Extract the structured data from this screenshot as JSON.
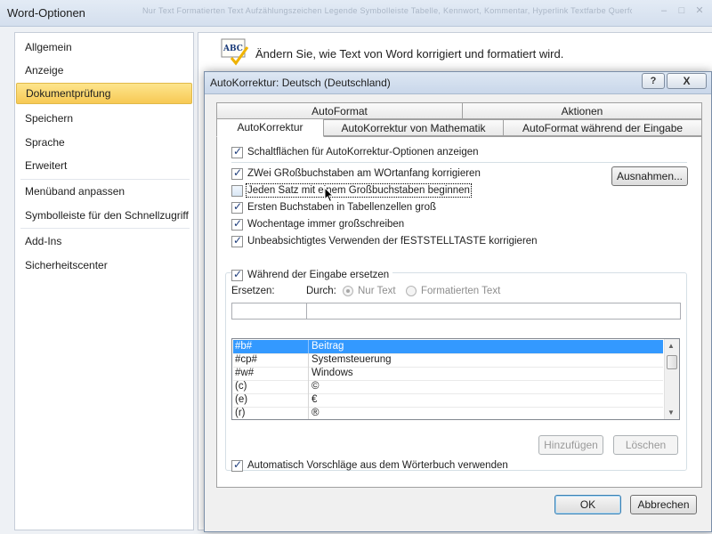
{
  "window": {
    "title": "Word-Optionen",
    "background_text": "Nur Text Formatierten Text Aufzählungszeichen Legende Symbolleiste Tabelle, Kennwort, Kommentar, Hyperlink Textfarbe Querformat Dokument Layout Ansicht"
  },
  "nav": {
    "items": [
      {
        "label": "Allgemein"
      },
      {
        "label": "Anzeige"
      },
      {
        "label": "Dokumentprüfung"
      },
      {
        "label": "Speichern"
      },
      {
        "label": "Sprache"
      },
      {
        "label": "Erweitert"
      },
      {
        "label": "Menüband anpassen"
      },
      {
        "label": "Symbolleiste für den Schnellzugriff"
      },
      {
        "label": "Add-Ins"
      },
      {
        "label": "Sicherheitscenter"
      }
    ],
    "active_index": 2
  },
  "content": {
    "icon": "abc-check-icon",
    "icon_text": "ABC",
    "heading": "Ändern Sie, wie Text von Word korrigiert und formatiert wird."
  },
  "dialog": {
    "title": "AutoKorrektur: Deutsch (Deutschland)",
    "help_label": "?",
    "close_label": "X",
    "tabs_top": [
      "AutoFormat",
      "Aktionen"
    ],
    "tabs_bottom": [
      "AutoKorrektur",
      "AutoKorrektur von Mathematik",
      "AutoFormat während der Eingabe"
    ],
    "active_tab": "AutoKorrektur",
    "show_buttons_option": {
      "label": "Schaltflächen für AutoKorrektur-Optionen anzeigen",
      "checked": true
    },
    "options": [
      {
        "label": "ZWei GRoßbuchstaben am WOrtanfang korrigieren",
        "checked": true
      },
      {
        "label": "Jeden Satz mit einem Großbuchstaben beginnen",
        "checked": false
      },
      {
        "label": "Ersten Buchstaben in Tabellenzellen groß",
        "checked": true
      },
      {
        "label": "Wochentage immer großschreiben",
        "checked": true
      },
      {
        "label": "Unbeabsichtigtes Verwenden der fESTSTELLTASTE korrigieren",
        "checked": true
      }
    ],
    "exceptions_button": "Ausnahmen...",
    "replace_group": {
      "label": "Während der Eingabe ersetzen",
      "checked": true,
      "replace_label": "Ersetzen:",
      "with_label": "Durch:",
      "radio_plain": "Nur Text",
      "radio_formatted": "Formatierten Text",
      "radio_selected": "plain",
      "replace_value": "",
      "with_value": ""
    },
    "list": {
      "rows": [
        {
          "from": "#b#",
          "to": "Beitrag"
        },
        {
          "from": "#cp#",
          "to": "Systemsteuerung"
        },
        {
          "from": "#w#",
          "to": "Windows"
        },
        {
          "from": "(c)",
          "to": "©"
        },
        {
          "from": "(e)",
          "to": "€"
        },
        {
          "from": "(r)",
          "to": "®"
        }
      ],
      "selected_index": 0
    },
    "add_button": "Hinzufügen",
    "delete_button": "Löschen",
    "suggestions_option": {
      "label": "Automatisch Vorschläge aus dem Wörterbuch verwenden",
      "checked": true
    },
    "ok_button": "OK",
    "cancel_button": "Abbrechen"
  },
  "colors": {
    "nav_active": "#f7c954",
    "selection": "#3399ff",
    "titlebar": "#d4dfee"
  }
}
